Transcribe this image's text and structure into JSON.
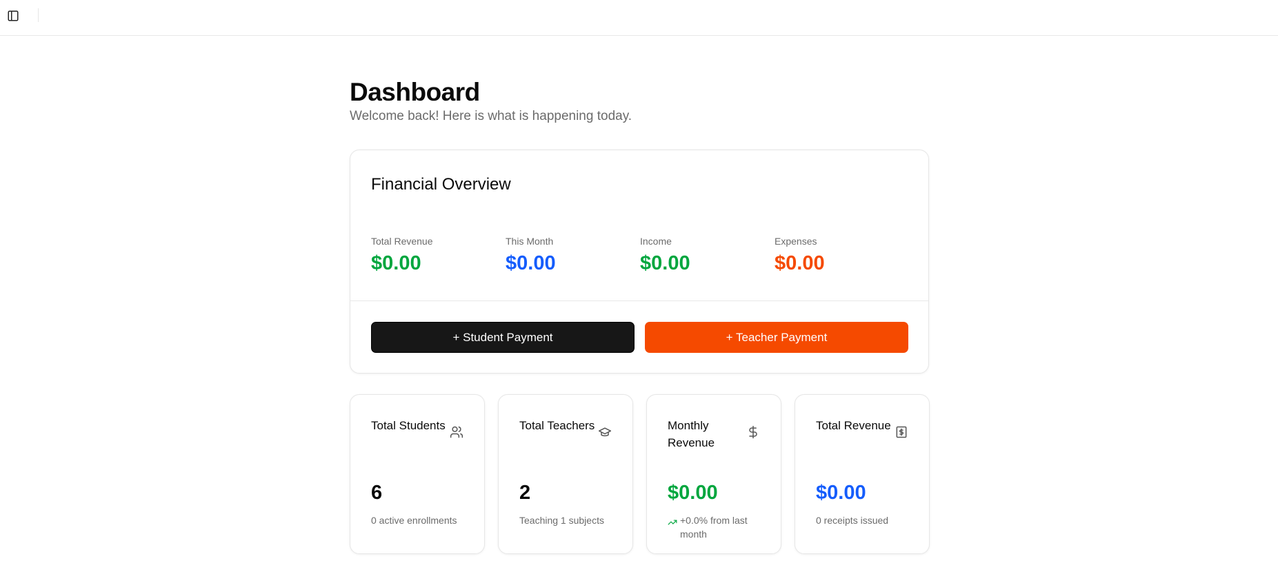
{
  "topbar": {
    "toggle_icon": "sidebar-toggle-icon"
  },
  "header": {
    "title": "Dashboard",
    "subtitle": "Welcome back! Here is what is happening today."
  },
  "financial_overview": {
    "title": "Financial Overview",
    "stats": [
      {
        "label": "Total Revenue",
        "value": "$0.00",
        "color": "#00a63e"
      },
      {
        "label": "This Month",
        "value": "$0.00",
        "color": "#155dfc"
      },
      {
        "label": "Income",
        "value": "$0.00",
        "color": "#00a63e"
      },
      {
        "label": "Expenses",
        "value": "$0.00",
        "color": "#f54a00"
      }
    ],
    "student_payment_label": "+ Student Payment",
    "teacher_payment_label": "+ Teacher Payment"
  },
  "stat_cards": [
    {
      "title": "Total Students",
      "icon": "users-icon",
      "value": "6",
      "sub": "0 active enrollments",
      "value_color": "#0a0a0a"
    },
    {
      "title": "Total Teachers",
      "icon": "graduation-cap-icon",
      "value": "2",
      "sub": "Teaching 1 subjects",
      "value_color": "#0a0a0a"
    },
    {
      "title": "Monthly Revenue",
      "icon": "dollar-sign-icon",
      "value": "$0.00",
      "sub": "+0.0% from last month",
      "value_color": "#00a63e",
      "trend_icon": "trending-up-icon"
    },
    {
      "title": "Total Revenue",
      "icon": "receipt-icon",
      "value": "$0.00",
      "sub": "0 receipts issued",
      "value_color": "#155dfc"
    }
  ]
}
